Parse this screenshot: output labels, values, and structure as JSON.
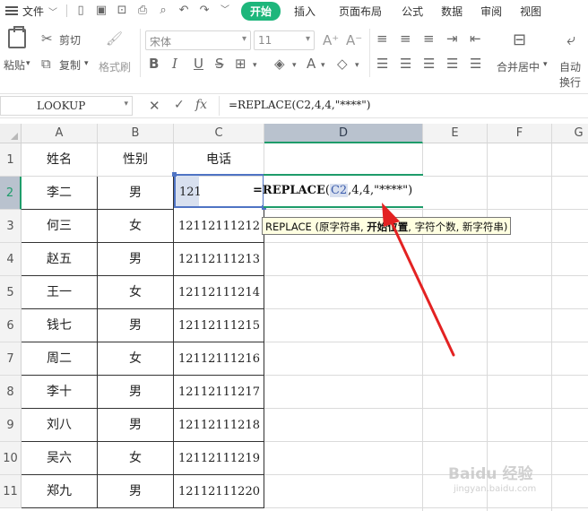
{
  "menubar": {
    "file_label": "文件",
    "tabs": [
      "开始",
      "插入",
      "页面布局",
      "公式",
      "数据",
      "审阅",
      "视图"
    ],
    "active_tab": "开始"
  },
  "toolbar": {
    "paste_label": "粘贴",
    "cut_label": "剪切",
    "copy_label": "复制",
    "format_painter_label": "格式刷",
    "font_name": "宋体",
    "font_size": "11",
    "merge_label": "合并居中",
    "wrap_label": "自动换行",
    "bold_glyph": "B",
    "italic_glyph": "I",
    "underline_glyph": "U"
  },
  "formula_bar": {
    "name_box": "LOOKUP",
    "formula": "=REPLACE(C2,4,4,\"****\")",
    "fx_label": "fx"
  },
  "columns": [
    "A",
    "B",
    "C",
    "D",
    "E",
    "F",
    "G"
  ],
  "selected_column": "D",
  "selected_row": "2",
  "rows": [
    {
      "n": "1",
      "a": "姓名",
      "b": "性别",
      "c": "电话"
    },
    {
      "n": "2",
      "a": "李二",
      "b": "男",
      "c": "121"
    },
    {
      "n": "3",
      "a": "何三",
      "b": "女",
      "c": "12112111212"
    },
    {
      "n": "4",
      "a": "赵五",
      "b": "男",
      "c": "12112111213"
    },
    {
      "n": "5",
      "a": "王一",
      "b": "女",
      "c": "12112111214"
    },
    {
      "n": "6",
      "a": "钱七",
      "b": "男",
      "c": "12112111215"
    },
    {
      "n": "7",
      "a": "周二",
      "b": "女",
      "c": "12112111216"
    },
    {
      "n": "8",
      "a": "李十",
      "b": "男",
      "c": "12112111217"
    },
    {
      "n": "9",
      "a": "刘八",
      "b": "男",
      "c": "12112111218"
    },
    {
      "n": "10",
      "a": "吴六",
      "b": "女",
      "c": "12112111219"
    },
    {
      "n": "11",
      "a": "郑九",
      "b": "男",
      "c": "12112111220"
    }
  ],
  "editing": {
    "prefix": "=REPLACE",
    "open_paren": "(",
    "ref": "C2",
    "rest": ",4,4,\"****\")"
  },
  "tooltip": {
    "func": "REPLACE (原字符串, ",
    "current_arg": "开始位置",
    "rest": ", 字符个数, 新字符串)"
  },
  "watermark": {
    "brand": "Baidu 经验",
    "url": "jingyan.baidu.com"
  },
  "colors": {
    "accent": "#1db67b",
    "selection_blue": "#4f74c4",
    "arrow_red": "#e32222"
  }
}
